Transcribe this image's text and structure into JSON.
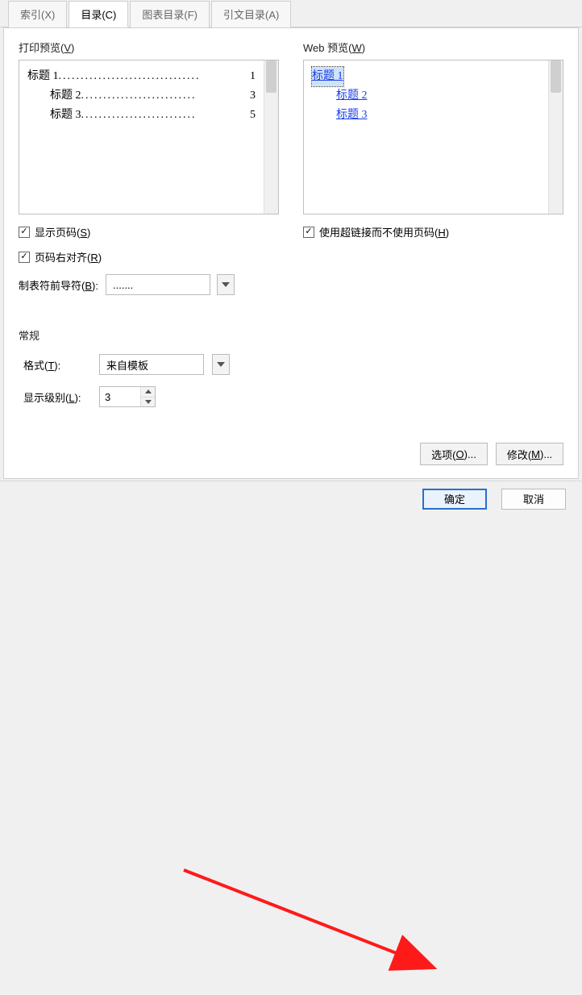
{
  "tabs": {
    "index": "索引(X)",
    "toc": "目录(C)",
    "figures": "图表目录(F)",
    "citations": "引文目录(A)"
  },
  "left": {
    "title_pre": "打印预览(",
    "title_u": "V",
    "title_post": ")",
    "items": [
      {
        "title": "标题 1",
        "dots": "................................",
        "page": "1",
        "indent": 0
      },
      {
        "title": "标题 2",
        "dots": "..........................",
        "page": "3",
        "indent": 1
      },
      {
        "title": "标题 3",
        "dots": "..........................",
        "page": "5",
        "indent": 1
      }
    ],
    "show_page_pre": "显示页码(",
    "show_page_u": "S",
    "show_page_post": ")",
    "right_align_pre": "页码右对齐(",
    "right_align_u": "R",
    "right_align_post": ")",
    "leader_pre": "制表符前导符(",
    "leader_u": "B",
    "leader_post": "):",
    "leader_value": "......."
  },
  "right": {
    "title_pre": "Web 预览(",
    "title_u": "W",
    "title_post": ")",
    "items": [
      {
        "label": "标题 1",
        "indent": 0,
        "selected": true
      },
      {
        "label": "标题 2",
        "indent": 1,
        "selected": false
      },
      {
        "label": "标题 3",
        "indent": 2,
        "selected": false
      }
    ],
    "hyperlink_pre": "使用超链接而不使用页码(",
    "hyperlink_u": "H",
    "hyperlink_post": ")"
  },
  "general": {
    "heading": "常规",
    "format_pre": "格式(",
    "format_u": "T",
    "format_post": "):",
    "format_value": "来自模板",
    "level_pre": "显示级别(",
    "level_u": "L",
    "level_post": "):",
    "level_value": "3"
  },
  "buttons": {
    "options_pre": "选项(",
    "options_u": "O",
    "options_post": ")...",
    "modify_pre": "修改(",
    "modify_u": "M",
    "modify_post": ")...",
    "ok": "确定",
    "cancel": "取消"
  }
}
